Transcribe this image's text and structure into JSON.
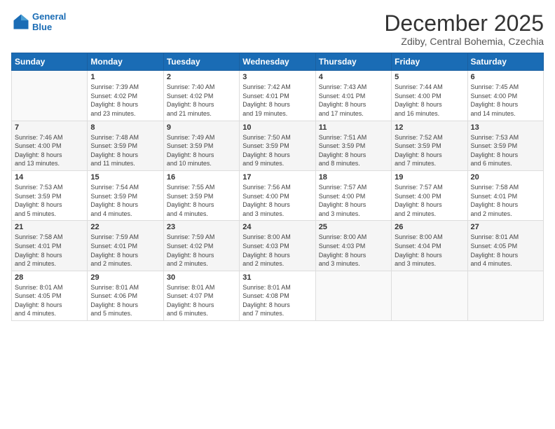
{
  "header": {
    "logo_line1": "General",
    "logo_line2": "Blue",
    "month_title": "December 2025",
    "location": "Zdiby, Central Bohemia, Czechia"
  },
  "days_of_week": [
    "Sunday",
    "Monday",
    "Tuesday",
    "Wednesday",
    "Thursday",
    "Friday",
    "Saturday"
  ],
  "weeks": [
    [
      {
        "day": "",
        "info": ""
      },
      {
        "day": "1",
        "info": "Sunrise: 7:39 AM\nSunset: 4:02 PM\nDaylight: 8 hours\nand 23 minutes."
      },
      {
        "day": "2",
        "info": "Sunrise: 7:40 AM\nSunset: 4:02 PM\nDaylight: 8 hours\nand 21 minutes."
      },
      {
        "day": "3",
        "info": "Sunrise: 7:42 AM\nSunset: 4:01 PM\nDaylight: 8 hours\nand 19 minutes."
      },
      {
        "day": "4",
        "info": "Sunrise: 7:43 AM\nSunset: 4:01 PM\nDaylight: 8 hours\nand 17 minutes."
      },
      {
        "day": "5",
        "info": "Sunrise: 7:44 AM\nSunset: 4:00 PM\nDaylight: 8 hours\nand 16 minutes."
      },
      {
        "day": "6",
        "info": "Sunrise: 7:45 AM\nSunset: 4:00 PM\nDaylight: 8 hours\nand 14 minutes."
      }
    ],
    [
      {
        "day": "7",
        "info": "Sunrise: 7:46 AM\nSunset: 4:00 PM\nDaylight: 8 hours\nand 13 minutes."
      },
      {
        "day": "8",
        "info": "Sunrise: 7:48 AM\nSunset: 3:59 PM\nDaylight: 8 hours\nand 11 minutes."
      },
      {
        "day": "9",
        "info": "Sunrise: 7:49 AM\nSunset: 3:59 PM\nDaylight: 8 hours\nand 10 minutes."
      },
      {
        "day": "10",
        "info": "Sunrise: 7:50 AM\nSunset: 3:59 PM\nDaylight: 8 hours\nand 9 minutes."
      },
      {
        "day": "11",
        "info": "Sunrise: 7:51 AM\nSunset: 3:59 PM\nDaylight: 8 hours\nand 8 minutes."
      },
      {
        "day": "12",
        "info": "Sunrise: 7:52 AM\nSunset: 3:59 PM\nDaylight: 8 hours\nand 7 minutes."
      },
      {
        "day": "13",
        "info": "Sunrise: 7:53 AM\nSunset: 3:59 PM\nDaylight: 8 hours\nand 6 minutes."
      }
    ],
    [
      {
        "day": "14",
        "info": "Sunrise: 7:53 AM\nSunset: 3:59 PM\nDaylight: 8 hours\nand 5 minutes."
      },
      {
        "day": "15",
        "info": "Sunrise: 7:54 AM\nSunset: 3:59 PM\nDaylight: 8 hours\nand 4 minutes."
      },
      {
        "day": "16",
        "info": "Sunrise: 7:55 AM\nSunset: 3:59 PM\nDaylight: 8 hours\nand 4 minutes."
      },
      {
        "day": "17",
        "info": "Sunrise: 7:56 AM\nSunset: 4:00 PM\nDaylight: 8 hours\nand 3 minutes."
      },
      {
        "day": "18",
        "info": "Sunrise: 7:57 AM\nSunset: 4:00 PM\nDaylight: 8 hours\nand 3 minutes."
      },
      {
        "day": "19",
        "info": "Sunrise: 7:57 AM\nSunset: 4:00 PM\nDaylight: 8 hours\nand 2 minutes."
      },
      {
        "day": "20",
        "info": "Sunrise: 7:58 AM\nSunset: 4:01 PM\nDaylight: 8 hours\nand 2 minutes."
      }
    ],
    [
      {
        "day": "21",
        "info": "Sunrise: 7:58 AM\nSunset: 4:01 PM\nDaylight: 8 hours\nand 2 minutes."
      },
      {
        "day": "22",
        "info": "Sunrise: 7:59 AM\nSunset: 4:01 PM\nDaylight: 8 hours\nand 2 minutes."
      },
      {
        "day": "23",
        "info": "Sunrise: 7:59 AM\nSunset: 4:02 PM\nDaylight: 8 hours\nand 2 minutes."
      },
      {
        "day": "24",
        "info": "Sunrise: 8:00 AM\nSunset: 4:03 PM\nDaylight: 8 hours\nand 2 minutes."
      },
      {
        "day": "25",
        "info": "Sunrise: 8:00 AM\nSunset: 4:03 PM\nDaylight: 8 hours\nand 3 minutes."
      },
      {
        "day": "26",
        "info": "Sunrise: 8:00 AM\nSunset: 4:04 PM\nDaylight: 8 hours\nand 3 minutes."
      },
      {
        "day": "27",
        "info": "Sunrise: 8:01 AM\nSunset: 4:05 PM\nDaylight: 8 hours\nand 4 minutes."
      }
    ],
    [
      {
        "day": "28",
        "info": "Sunrise: 8:01 AM\nSunset: 4:05 PM\nDaylight: 8 hours\nand 4 minutes."
      },
      {
        "day": "29",
        "info": "Sunrise: 8:01 AM\nSunset: 4:06 PM\nDaylight: 8 hours\nand 5 minutes."
      },
      {
        "day": "30",
        "info": "Sunrise: 8:01 AM\nSunset: 4:07 PM\nDaylight: 8 hours\nand 6 minutes."
      },
      {
        "day": "31",
        "info": "Sunrise: 8:01 AM\nSunset: 4:08 PM\nDaylight: 8 hours\nand 7 minutes."
      },
      {
        "day": "",
        "info": ""
      },
      {
        "day": "",
        "info": ""
      },
      {
        "day": "",
        "info": ""
      }
    ]
  ]
}
